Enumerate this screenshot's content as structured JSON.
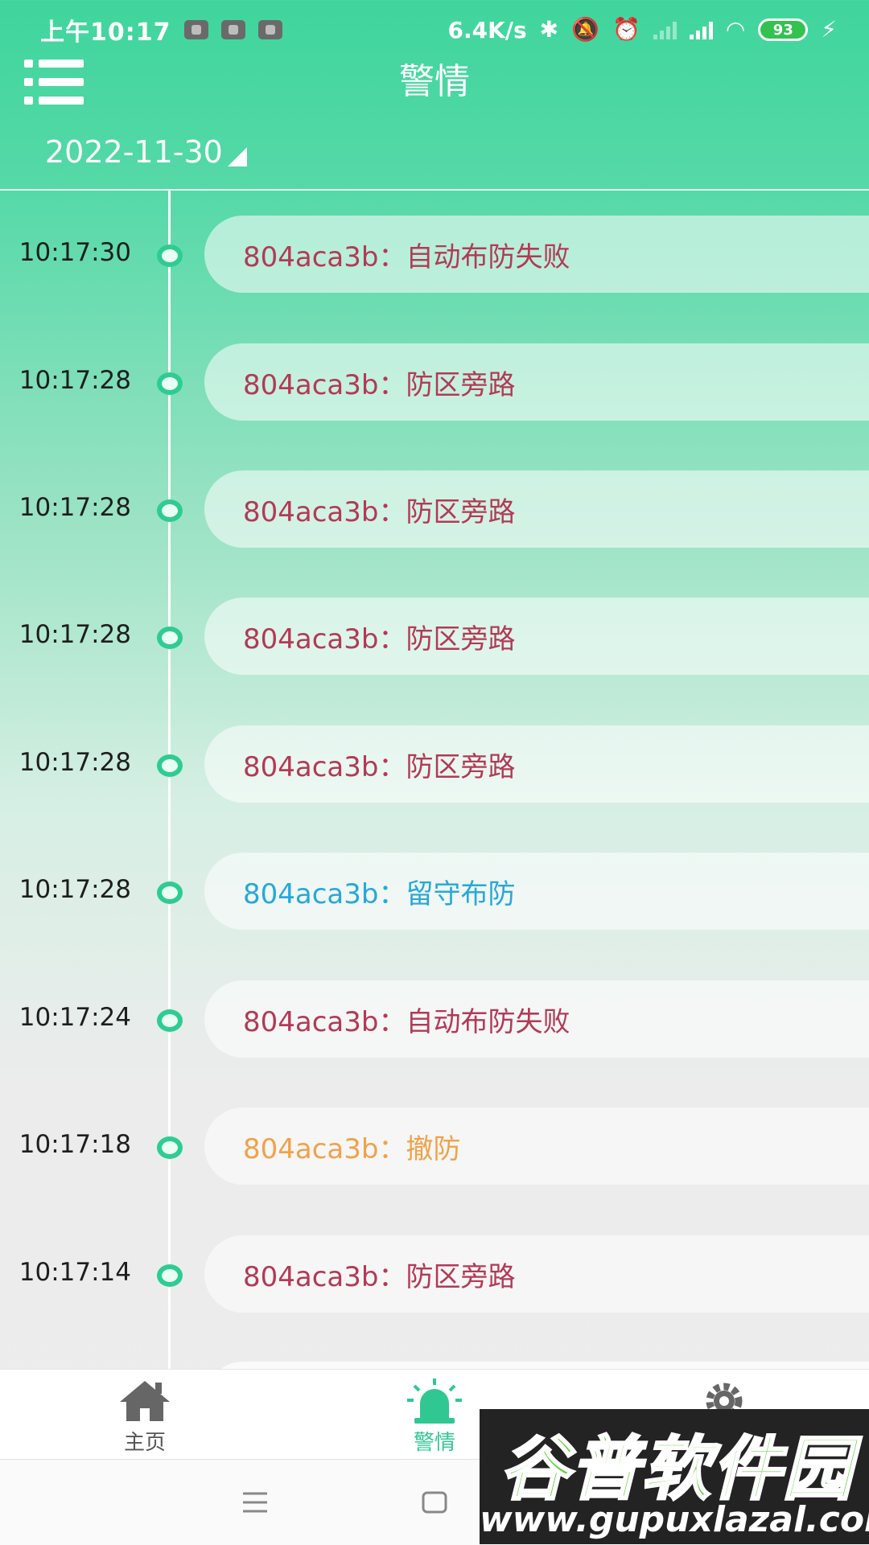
{
  "status_bar": {
    "time": "上午10:17",
    "net_speed": "6.4K/s",
    "battery": "93"
  },
  "header": {
    "title": "警情",
    "date": "2022-11-30"
  },
  "alarms": [
    {
      "time": "10:17:30",
      "text": "804aca3b：自动布防失败",
      "color": "#b23a55"
    },
    {
      "time": "10:17:28",
      "text": "804aca3b：防区旁路",
      "color": "#b23a55"
    },
    {
      "time": "10:17:28",
      "text": "804aca3b：防区旁路",
      "color": "#b23a55"
    },
    {
      "time": "10:17:28",
      "text": "804aca3b：防区旁路",
      "color": "#b23a55"
    },
    {
      "time": "10:17:28",
      "text": "804aca3b：防区旁路",
      "color": "#b23a55"
    },
    {
      "time": "10:17:28",
      "text": "804aca3b：留守布防",
      "color": "#27a8d9"
    },
    {
      "time": "10:17:24",
      "text": "804aca3b：自动布防失败",
      "color": "#b23a55"
    },
    {
      "time": "10:17:18",
      "text": "804aca3b：撤防",
      "color": "#f0a24a"
    },
    {
      "time": "10:17:14",
      "text": "804aca3b：防区旁路",
      "color": "#b23a55"
    }
  ],
  "bottom_nav": [
    {
      "label": "主页",
      "icon": "home-icon",
      "active": false
    },
    {
      "label": "警情",
      "icon": "alarm-siren-icon",
      "active": true
    },
    {
      "label": "设置",
      "icon": "gear-icon",
      "active": false
    }
  ],
  "watermark": {
    "title": "谷普软件园",
    "url": "www.gupuxlazal.com"
  },
  "colors": {
    "accent": "#2fc893",
    "alarm_red": "#b23a55",
    "alarm_blue": "#27a8d9",
    "alarm_orange": "#f0a24a"
  }
}
